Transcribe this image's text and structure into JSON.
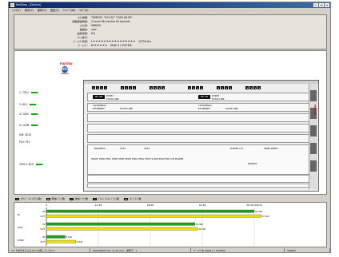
{
  "window": {
    "title": "NetDiag - [Device]"
  },
  "menubar": [
    "ﾌｧｲﾙ(F)",
    "表示(V)",
    "操作(O)",
    "設定(S)",
    "ｳｨﾝﾄﾞｳ(W)",
    "ﾍﾙﾌﾟ(H)"
  ],
  "info": [
    {
      "label": "ｼｽﾃﾑ情報:",
      "value": "\"SR8000\"  \"V01.00\"  \"2000.08.08\""
    },
    {
      "label": "起動経過時間:",
      "value": "2 hours 48 minutes 00 seconds"
    },
    {
      "label": "ｼｽﾃﾑ名:",
      "value": "SR8000"
    },
    {
      "label": "連絡先:",
      "value": "user"
    },
    {
      "label": "設置場所:",
      "value": "HQ"
    },
    {
      "label": "ｱﾗｰﾑ表示:",
      "value": ""
    },
    {
      "label": "ﾎﾟｰﾘﾝｸﾞ状態:",
      "value": "10750 sec.",
      "dots": true
    },
    {
      "label": "ﾎﾟｰﾘﾝｸﾞ:",
      "value": "PAGE 0 / SYSTEM"
    }
  ],
  "logo": {
    "top": "FUJITSU",
    "circle": "GEO",
    "sub": "SR8000"
  },
  "side_labels": [
    "1: 75V1",
    "2: 6L3",
    "3: 100C",
    "4: 1L0M",
    "5/B: 3010",
    "P10: P11",
    "1EVL2: 8C0"
  ],
  "chassis": {
    "slot1": {
      "seg1": "00 00",
      "seg2": "00 00",
      "text1": "PORT1",
      "text2": "FC/D0  LINK",
      "text3": "PORT2"
    },
    "slot2": {
      "text1": "10/100Base",
      "text2": "ETHERNET",
      "text3": "FC/D0  LINK"
    },
    "panel": {
      "labels": [
        "MAGNETS",
        "UFS2",
        "UFS3",
        "POWER  CTL",
        "SNMP  RESET"
      ],
      "strip": "0TRAF  0TRR  0TRL  0TRE  0TRE  0TRM  0TRA  0TRA  0TRH  S-ELM  ELM  0TPA  C/B  POWER",
      "strip2": "MSEBUS"
    },
    "vertical": "FUJITSU"
  },
  "legend": [
    {
      "label": "ｱｸﾃｨﾌﾞ (in ｵｸﾃｯﾄ数)",
      "color": "#1f9f1f"
    },
    {
      "label": "受信ﾊﾟｹｯﾄ数",
      "color": "#f0e000"
    },
    {
      "label": "送信ﾊﾟｹｯﾄ数",
      "color": "#2d8f2d"
    },
    {
      "label": "ﾌﾞﾛｰﾄﾞｷｬｽﾄ ﾊﾟｹｯﾄ数",
      "color": "#4060d0"
    },
    {
      "label": "ｴﾗｰﾊﾟｹｯﾄ数",
      "color": "#f0e000"
    }
  ],
  "chart_data": {
    "type": "bar",
    "orientation": "horizontal",
    "x_ticks": [
      "0",
      "14,38",
      "28,38",
      "42,38",
      "56,38 [Pkt/S]"
    ],
    "xlim": [
      0,
      56.38
    ],
    "groups": [
      {
        "name": "IP",
        "bars": [
          {
            "label": "IN",
            "value": 56.38,
            "color": "#1f9f1f",
            "data_label": "56.384"
          },
          {
            "label": "OUT",
            "value": 58.2,
            "color": "#f0e000",
            "data_label": "57.400"
          }
        ]
      },
      {
        "name": "UDP",
        "bars": [
          {
            "label": "IN",
            "value": 40.3,
            "color": "#1f9f1f",
            "data_label": "40.380"
          },
          {
            "label": "OUT",
            "value": 41.0,
            "color": "#f0e000",
            "data_label": "40.700"
          }
        ]
      },
      {
        "name": "ICMP",
        "bars": [
          {
            "label": "IN",
            "value": 5.1,
            "color": "#1f9f1f",
            "data_label": "5.100"
          },
          {
            "label": "OUT",
            "value": 8.0,
            "color": "#f0e000",
            "data_label": "8.440"
          }
        ]
      }
    ]
  },
  "statusbar": [
    "ﾍﾙﾌﾟを表示するには [F1] を押してください",
    "2000/08/08 ｱｸｾｽ: 10.10.10.5 - 参照モード",
    "ﾎﾟｰﾘﾝｸﾞ中 (PAGE 0 / SYSTEM)",
    "SR8000"
  ]
}
